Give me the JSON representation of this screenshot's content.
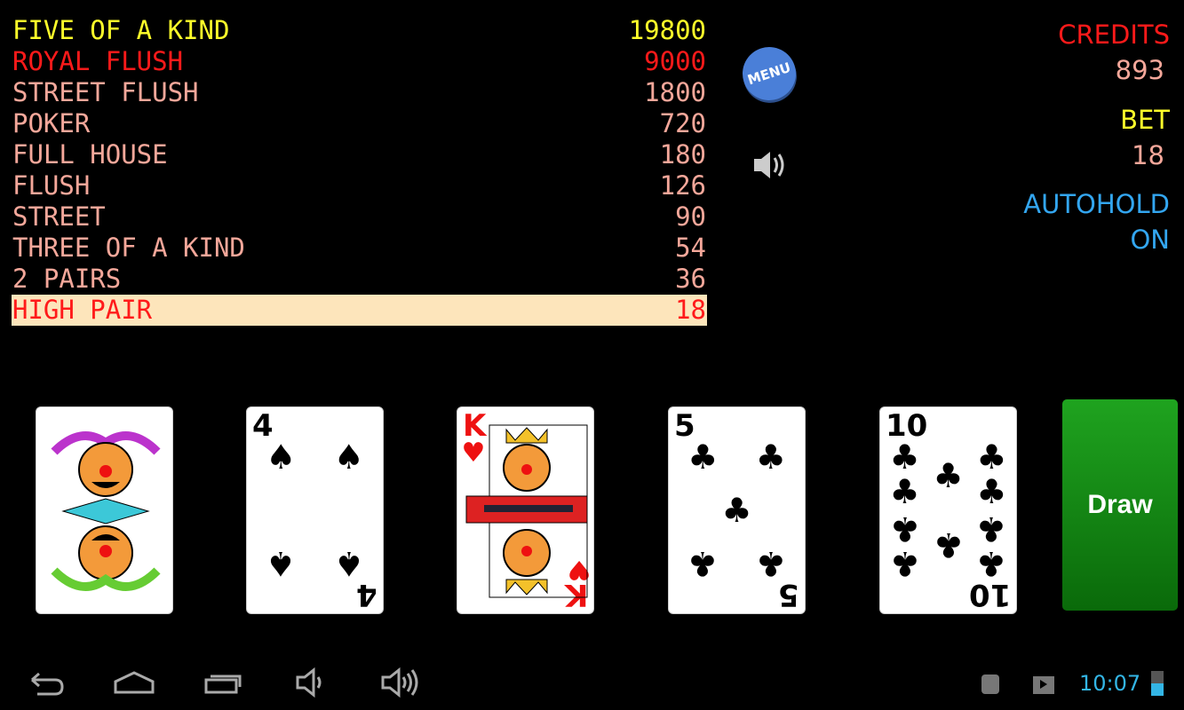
{
  "paytable": [
    {
      "hand": "FIVE OF A KIND",
      "payout": "19800",
      "color": "#ffff2a"
    },
    {
      "hand": "ROYAL FLUSH",
      "payout": "9000",
      "color": "#ff1a1a"
    },
    {
      "hand": "STREET FLUSH",
      "payout": "1800",
      "color": "#f4a79a"
    },
    {
      "hand": "POKER",
      "payout": "720",
      "color": "#f4a79a"
    },
    {
      "hand": "FULL HOUSE",
      "payout": "180",
      "color": "#f4a79a"
    },
    {
      "hand": "FLUSH",
      "payout": "126",
      "color": "#f4a79a"
    },
    {
      "hand": "STREET",
      "payout": "90",
      "color": "#f4a79a"
    },
    {
      "hand": "THREE OF A KIND",
      "payout": "54",
      "color": "#f4a79a"
    },
    {
      "hand": "2 PAIRS",
      "payout": "36",
      "color": "#f4a79a"
    },
    {
      "hand": "HIGH PAIR",
      "payout": "18",
      "color": "#ff1a1a",
      "highlighted": true
    }
  ],
  "menu_label": "MENU",
  "sound_icon": "speaker-icon",
  "credits": {
    "label": "CREDITS",
    "value": "893"
  },
  "bet": {
    "label": "BET",
    "value": "18"
  },
  "autohold": {
    "label": "AUTOHOLD",
    "value": "ON"
  },
  "cards": [
    {
      "rank": "JOKER",
      "suit": ""
    },
    {
      "rank": "4",
      "suit": "spades"
    },
    {
      "rank": "K",
      "suit": "hearts"
    },
    {
      "rank": "5",
      "suit": "clubs"
    },
    {
      "rank": "10",
      "suit": "clubs"
    }
  ],
  "draw_label": "Draw",
  "status": {
    "time": "10:07"
  }
}
